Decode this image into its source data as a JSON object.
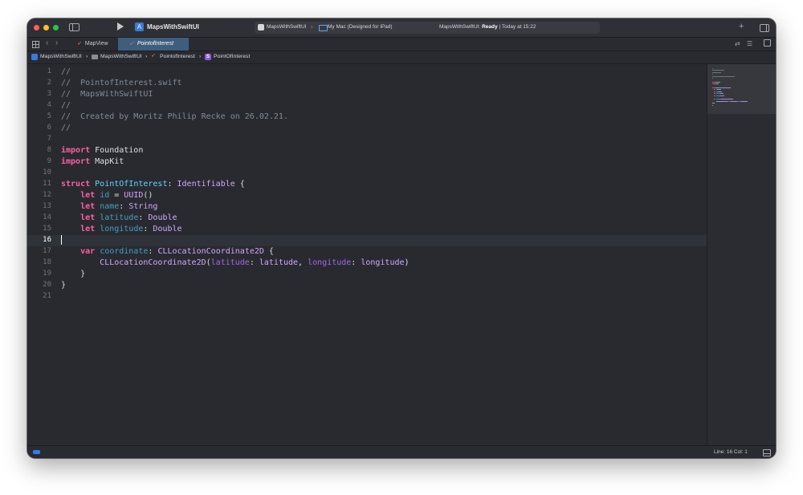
{
  "titlebar": {
    "app_title": "MapsWithSwiftUI",
    "scheme": "MapsWithSwiftUI",
    "destination": "My Mac (Designed for iPad)",
    "status_prefix": "MapsWithSwiftUI:",
    "status_state": "Ready",
    "status_time": "| Today at 15:22"
  },
  "tabs": [
    {
      "label": "MapView",
      "active": false
    },
    {
      "label": "PointofInterest",
      "active": true
    }
  ],
  "breadcrumb": {
    "project": "MapsWithSwiftUI",
    "group": "MapsWithSwiftUI",
    "file": "PointofInterest",
    "symbol": "PointOfInterest",
    "symbol_badge": "S"
  },
  "editor": {
    "current_line": 16,
    "line_numbers": [
      "1",
      "2",
      "3",
      "4",
      "5",
      "6",
      "7",
      "8",
      "9",
      "10",
      "11",
      "12",
      "13",
      "14",
      "15",
      "16",
      "17",
      "18",
      "19",
      "20",
      "21"
    ],
    "lines": [
      [
        {
          "t": "//",
          "c": "comment"
        }
      ],
      [
        {
          "t": "//  PointofInterest.swift",
          "c": "comment"
        }
      ],
      [
        {
          "t": "//  MapsWithSwiftUI",
          "c": "comment"
        }
      ],
      [
        {
          "t": "//",
          "c": "comment"
        }
      ],
      [
        {
          "t": "//  Created by Moritz Philip Recke on 26.02.21.",
          "c": "comment"
        }
      ],
      [
        {
          "t": "//",
          "c": "comment"
        }
      ],
      [],
      [
        {
          "t": "import",
          "c": "kw"
        },
        {
          "t": " Foundation",
          "c": "plain"
        }
      ],
      [
        {
          "t": "import",
          "c": "kw"
        },
        {
          "t": " MapKit",
          "c": "plain"
        }
      ],
      [],
      [
        {
          "t": "struct",
          "c": "kw"
        },
        {
          "t": " ",
          "c": "plain"
        },
        {
          "t": "PointOfInterest",
          "c": "type"
        },
        {
          "t": ": ",
          "c": "plain"
        },
        {
          "t": "Identifiable",
          "c": "other"
        },
        {
          "t": " {",
          "c": "plain"
        }
      ],
      [
        {
          "t": "    ",
          "c": "plain"
        },
        {
          "t": "let",
          "c": "kw"
        },
        {
          "t": " ",
          "c": "plain"
        },
        {
          "t": "id",
          "c": "decl"
        },
        {
          "t": " = ",
          "c": "plain"
        },
        {
          "t": "UUID",
          "c": "other"
        },
        {
          "t": "()",
          "c": "plain"
        }
      ],
      [
        {
          "t": "    ",
          "c": "plain"
        },
        {
          "t": "let",
          "c": "kw"
        },
        {
          "t": " ",
          "c": "plain"
        },
        {
          "t": "name",
          "c": "decl"
        },
        {
          "t": ": ",
          "c": "plain"
        },
        {
          "t": "String",
          "c": "other"
        }
      ],
      [
        {
          "t": "    ",
          "c": "plain"
        },
        {
          "t": "let",
          "c": "kw"
        },
        {
          "t": " ",
          "c": "plain"
        },
        {
          "t": "latitude",
          "c": "decl"
        },
        {
          "t": ": ",
          "c": "plain"
        },
        {
          "t": "Double",
          "c": "other"
        }
      ],
      [
        {
          "t": "    ",
          "c": "plain"
        },
        {
          "t": "let",
          "c": "kw"
        },
        {
          "t": " ",
          "c": "plain"
        },
        {
          "t": "longitude",
          "c": "decl"
        },
        {
          "t": ": ",
          "c": "plain"
        },
        {
          "t": "Double",
          "c": "other"
        }
      ],
      [],
      [
        {
          "t": "    ",
          "c": "plain"
        },
        {
          "t": "var",
          "c": "kw"
        },
        {
          "t": " ",
          "c": "plain"
        },
        {
          "t": "coordinate",
          "c": "decl"
        },
        {
          "t": ": ",
          "c": "plain"
        },
        {
          "t": "CLLocationCoordinate2D",
          "c": "other"
        },
        {
          "t": " {",
          "c": "plain"
        }
      ],
      [
        {
          "t": "        ",
          "c": "plain"
        },
        {
          "t": "CLLocationCoordinate2D",
          "c": "other"
        },
        {
          "t": "(",
          "c": "plain"
        },
        {
          "t": "latitude",
          "c": "otherprop"
        },
        {
          "t": ": ",
          "c": "plain"
        },
        {
          "t": "latitude",
          "c": "other"
        },
        {
          "t": ", ",
          "c": "plain"
        },
        {
          "t": "longitude",
          "c": "otherprop"
        },
        {
          "t": ": ",
          "c": "plain"
        },
        {
          "t": "longitude",
          "c": "other"
        },
        {
          "t": ")",
          "c": "plain"
        }
      ],
      [
        {
          "t": "    }",
          "c": "plain"
        }
      ],
      [
        {
          "t": "}",
          "c": "plain"
        }
      ],
      []
    ]
  },
  "statusbar": {
    "position": "Line: 16  Col: 1"
  },
  "colors": {
    "background": "#292a30",
    "keyword": "#fc5fa3",
    "comment": "#7f8c98",
    "type_declaration": "#5dd8ff",
    "other_type": "#d0a8ff",
    "accent": "#2f7ff0"
  },
  "icons": [
    "sidebar-icon",
    "play-icon",
    "app-icon",
    "plus-icon",
    "inspector-icon",
    "grid-icon",
    "back-icon",
    "forward-icon",
    "swift-file-icon",
    "folder-icon",
    "struct-icon",
    "debug-area-icon"
  ]
}
